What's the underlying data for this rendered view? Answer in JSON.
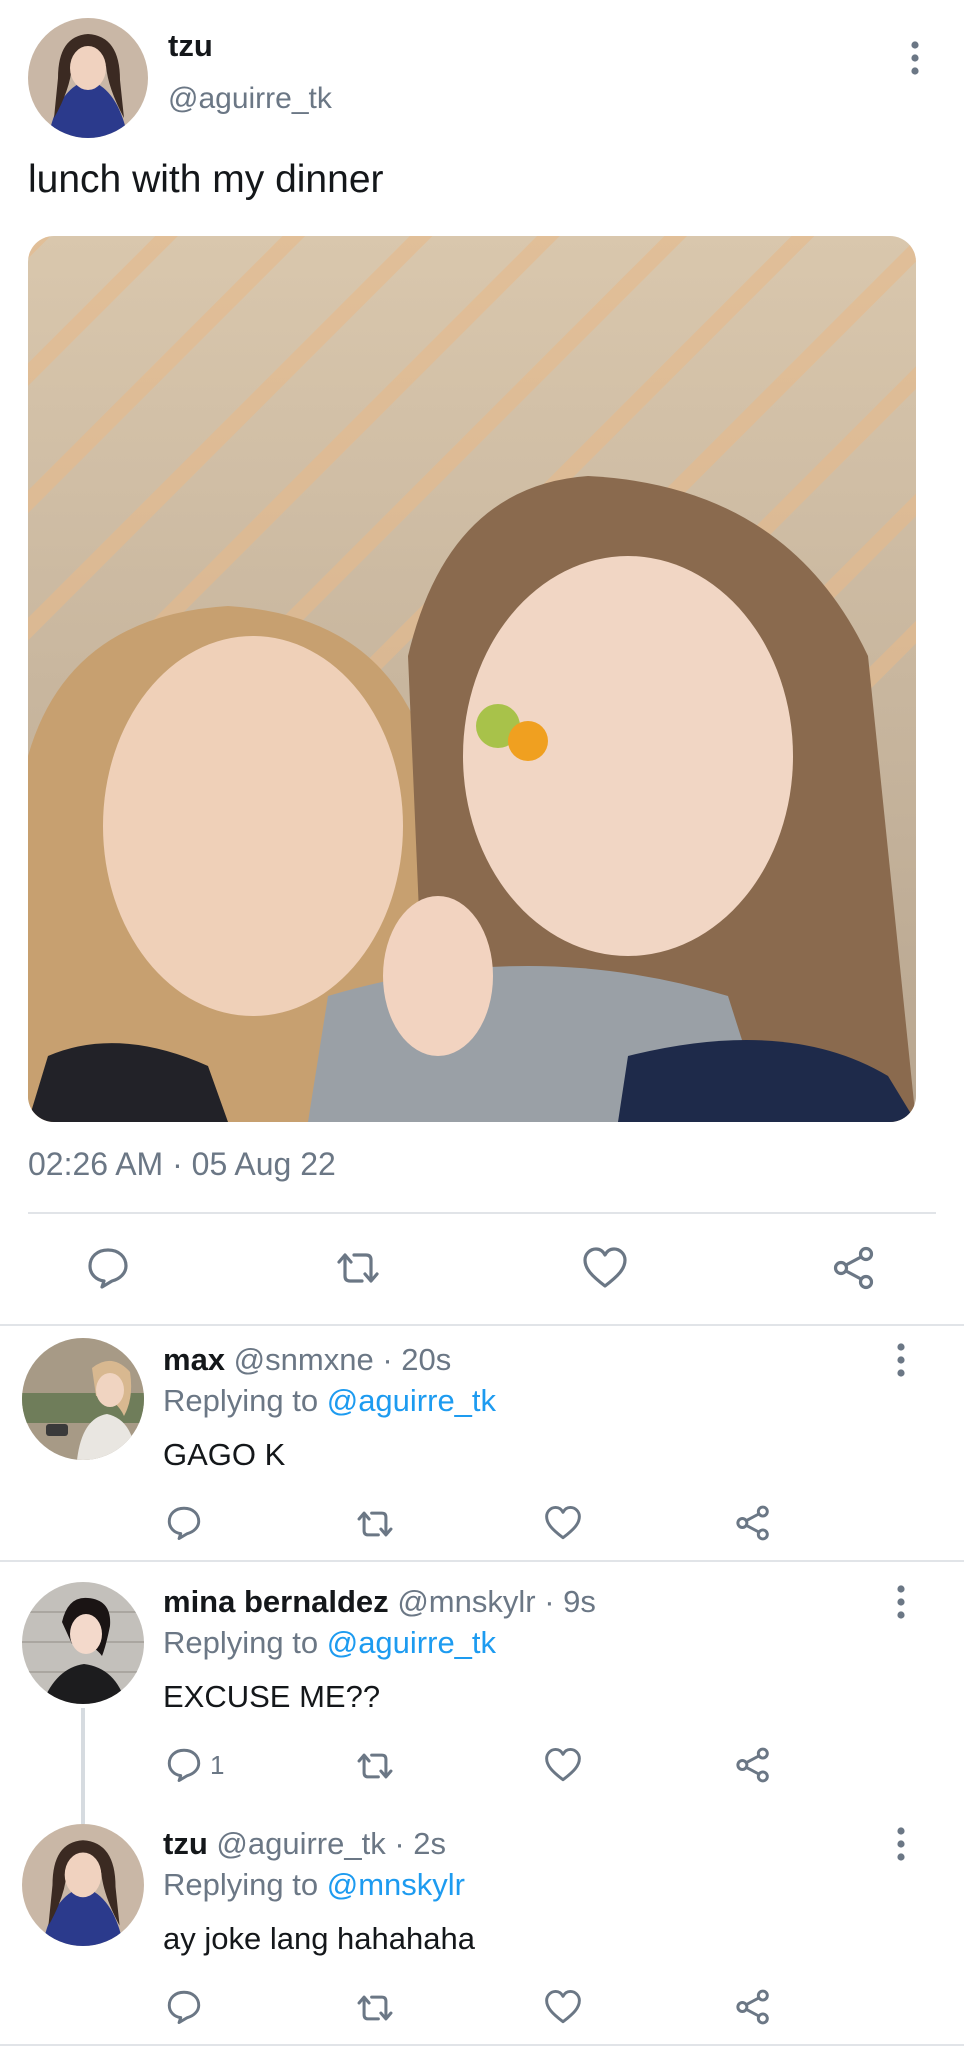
{
  "post": {
    "author": {
      "name": "tzu",
      "handle": "@aguirre_tk"
    },
    "text": "lunch with my dinner",
    "timestamp": "02:26 AM · 05 Aug 22"
  },
  "icons": {
    "reply": "reply-bubble-icon",
    "retweet": "retweet-icon",
    "like": "heart-icon",
    "share": "share-icon",
    "more": "more-vertical-icon"
  },
  "colors": {
    "text": "#14171a",
    "muted": "#6b7785",
    "accent": "#1d9bf0",
    "divider": "#e1e4e8"
  },
  "replies": [
    {
      "name": "max",
      "handle": "@snmxne",
      "time": "· 20s",
      "replying_prefix": "Replying to",
      "replying_to": "@aguirre_tk",
      "text": "GAGO K",
      "reply_count": ""
    },
    {
      "name": "mina bernaldez",
      "handle": "@mnskylr",
      "time": "· 9s",
      "replying_prefix": "Replying to",
      "replying_to": "@aguirre_tk",
      "text": "EXCUSE ME??",
      "reply_count": "1"
    },
    {
      "name": "tzu",
      "handle": "@aguirre_tk",
      "time": "· 2s",
      "replying_prefix": "Replying to",
      "replying_to": "@mnskylr",
      "text": "ay joke lang hahahaha",
      "reply_count": ""
    }
  ]
}
